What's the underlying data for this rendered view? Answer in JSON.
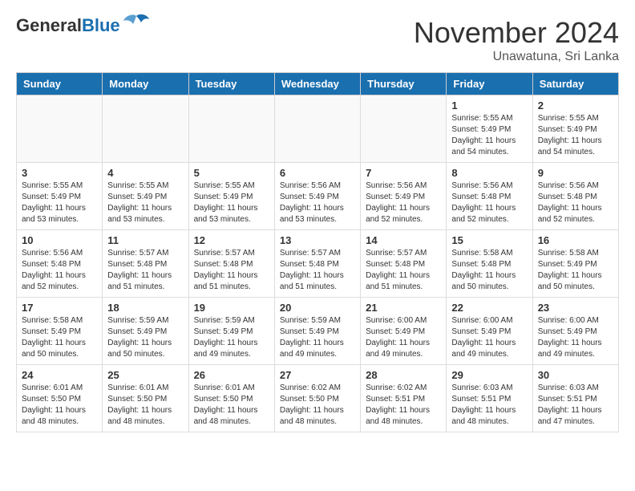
{
  "header": {
    "logo_general": "General",
    "logo_blue": "Blue",
    "month_title": "November 2024",
    "location": "Unawatuna, Sri Lanka"
  },
  "days_of_week": [
    "Sunday",
    "Monday",
    "Tuesday",
    "Wednesday",
    "Thursday",
    "Friday",
    "Saturday"
  ],
  "weeks": [
    [
      {
        "day": "",
        "info": ""
      },
      {
        "day": "",
        "info": ""
      },
      {
        "day": "",
        "info": ""
      },
      {
        "day": "",
        "info": ""
      },
      {
        "day": "",
        "info": ""
      },
      {
        "day": "1",
        "info": "Sunrise: 5:55 AM\nSunset: 5:49 PM\nDaylight: 11 hours\nand 54 minutes."
      },
      {
        "day": "2",
        "info": "Sunrise: 5:55 AM\nSunset: 5:49 PM\nDaylight: 11 hours\nand 54 minutes."
      }
    ],
    [
      {
        "day": "3",
        "info": "Sunrise: 5:55 AM\nSunset: 5:49 PM\nDaylight: 11 hours\nand 53 minutes."
      },
      {
        "day": "4",
        "info": "Sunrise: 5:55 AM\nSunset: 5:49 PM\nDaylight: 11 hours\nand 53 minutes."
      },
      {
        "day": "5",
        "info": "Sunrise: 5:55 AM\nSunset: 5:49 PM\nDaylight: 11 hours\nand 53 minutes."
      },
      {
        "day": "6",
        "info": "Sunrise: 5:56 AM\nSunset: 5:49 PM\nDaylight: 11 hours\nand 53 minutes."
      },
      {
        "day": "7",
        "info": "Sunrise: 5:56 AM\nSunset: 5:49 PM\nDaylight: 11 hours\nand 52 minutes."
      },
      {
        "day": "8",
        "info": "Sunrise: 5:56 AM\nSunset: 5:48 PM\nDaylight: 11 hours\nand 52 minutes."
      },
      {
        "day": "9",
        "info": "Sunrise: 5:56 AM\nSunset: 5:48 PM\nDaylight: 11 hours\nand 52 minutes."
      }
    ],
    [
      {
        "day": "10",
        "info": "Sunrise: 5:56 AM\nSunset: 5:48 PM\nDaylight: 11 hours\nand 52 minutes."
      },
      {
        "day": "11",
        "info": "Sunrise: 5:57 AM\nSunset: 5:48 PM\nDaylight: 11 hours\nand 51 minutes."
      },
      {
        "day": "12",
        "info": "Sunrise: 5:57 AM\nSunset: 5:48 PM\nDaylight: 11 hours\nand 51 minutes."
      },
      {
        "day": "13",
        "info": "Sunrise: 5:57 AM\nSunset: 5:48 PM\nDaylight: 11 hours\nand 51 minutes."
      },
      {
        "day": "14",
        "info": "Sunrise: 5:57 AM\nSunset: 5:48 PM\nDaylight: 11 hours\nand 51 minutes."
      },
      {
        "day": "15",
        "info": "Sunrise: 5:58 AM\nSunset: 5:48 PM\nDaylight: 11 hours\nand 50 minutes."
      },
      {
        "day": "16",
        "info": "Sunrise: 5:58 AM\nSunset: 5:49 PM\nDaylight: 11 hours\nand 50 minutes."
      }
    ],
    [
      {
        "day": "17",
        "info": "Sunrise: 5:58 AM\nSunset: 5:49 PM\nDaylight: 11 hours\nand 50 minutes."
      },
      {
        "day": "18",
        "info": "Sunrise: 5:59 AM\nSunset: 5:49 PM\nDaylight: 11 hours\nand 50 minutes."
      },
      {
        "day": "19",
        "info": "Sunrise: 5:59 AM\nSunset: 5:49 PM\nDaylight: 11 hours\nand 49 minutes."
      },
      {
        "day": "20",
        "info": "Sunrise: 5:59 AM\nSunset: 5:49 PM\nDaylight: 11 hours\nand 49 minutes."
      },
      {
        "day": "21",
        "info": "Sunrise: 6:00 AM\nSunset: 5:49 PM\nDaylight: 11 hours\nand 49 minutes."
      },
      {
        "day": "22",
        "info": "Sunrise: 6:00 AM\nSunset: 5:49 PM\nDaylight: 11 hours\nand 49 minutes."
      },
      {
        "day": "23",
        "info": "Sunrise: 6:00 AM\nSunset: 5:49 PM\nDaylight: 11 hours\nand 49 minutes."
      }
    ],
    [
      {
        "day": "24",
        "info": "Sunrise: 6:01 AM\nSunset: 5:50 PM\nDaylight: 11 hours\nand 48 minutes."
      },
      {
        "day": "25",
        "info": "Sunrise: 6:01 AM\nSunset: 5:50 PM\nDaylight: 11 hours\nand 48 minutes."
      },
      {
        "day": "26",
        "info": "Sunrise: 6:01 AM\nSunset: 5:50 PM\nDaylight: 11 hours\nand 48 minutes."
      },
      {
        "day": "27",
        "info": "Sunrise: 6:02 AM\nSunset: 5:50 PM\nDaylight: 11 hours\nand 48 minutes."
      },
      {
        "day": "28",
        "info": "Sunrise: 6:02 AM\nSunset: 5:51 PM\nDaylight: 11 hours\nand 48 minutes."
      },
      {
        "day": "29",
        "info": "Sunrise: 6:03 AM\nSunset: 5:51 PM\nDaylight: 11 hours\nand 48 minutes."
      },
      {
        "day": "30",
        "info": "Sunrise: 6:03 AM\nSunset: 5:51 PM\nDaylight: 11 hours\nand 47 minutes."
      }
    ]
  ]
}
